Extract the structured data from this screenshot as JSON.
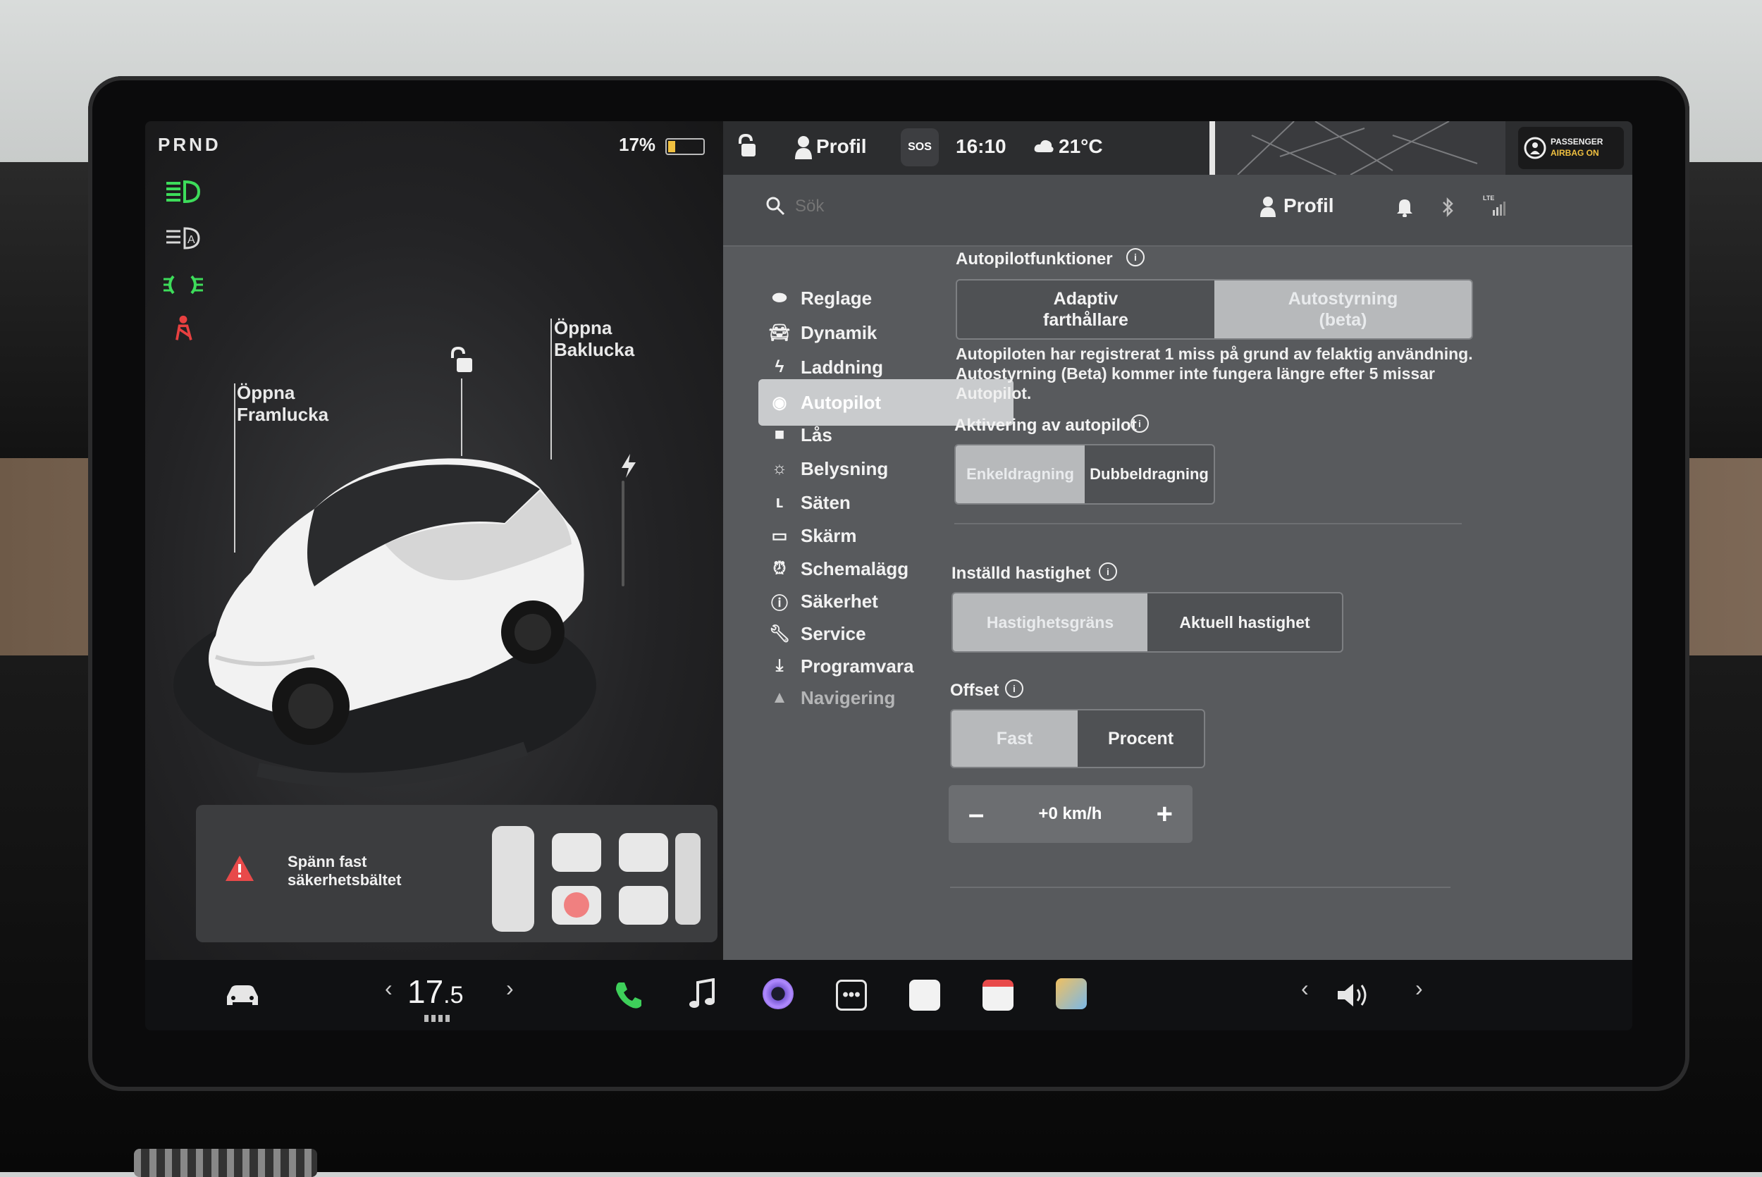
{
  "drive": {
    "gear": "PRND",
    "battery": "17%",
    "callout_frunk": "Öppna\nFramlucka",
    "callout_trunk": "Öppna\nBaklucka",
    "seatbelt_alert": "Spänn fast\nsäkerhetsbältet"
  },
  "statusbar": {
    "profile": "Profil",
    "sos": "SOS",
    "time": "16:10",
    "temperature": "21°C",
    "airbag_line1": "PASSENGER",
    "airbag_line2": "AIRBAG ON"
  },
  "search": {
    "placeholder": "Sök",
    "profile": "Profil"
  },
  "nav": {
    "items": [
      {
        "label": "Reglage",
        "icon": "toggle-icon"
      },
      {
        "label": "Dynamik",
        "icon": "car-icon"
      },
      {
        "label": "Laddning",
        "icon": "lightning-icon"
      },
      {
        "label": "Autopilot",
        "icon": "steering-wheel-icon"
      },
      {
        "label": "Lås",
        "icon": "lock-icon"
      },
      {
        "label": "Belysning",
        "icon": "sun-icon"
      },
      {
        "label": "Säten",
        "icon": "seat-icon"
      },
      {
        "label": "Skärm",
        "icon": "display-icon"
      },
      {
        "label": "Schemalägg",
        "icon": "alarm-clock-icon"
      },
      {
        "label": "Säkerhet",
        "icon": "alert-circle-icon"
      },
      {
        "label": "Service",
        "icon": "wrench-icon"
      },
      {
        "label": "Programvara",
        "icon": "download-icon"
      },
      {
        "label": "Navigering",
        "icon": "navigation-arrow-icon"
      }
    ],
    "active_index": 3
  },
  "autopilot": {
    "features_title": "Autopilotfunktioner",
    "features_options": [
      "Adaptiv\nfarthållare",
      "Autostyrning\n(beta)"
    ],
    "features_selected": 1,
    "strike_notice": "Autopiloten har registrerat 1 miss på grund av felaktig användning. Autostyrning (Beta) kommer inte fungera längre efter 5 missar Autopilot.",
    "activation_title": "Aktivering av autopilot",
    "activation_options": [
      "Enkeldragning",
      "Dubbeldragning"
    ],
    "activation_selected": 0,
    "speed_title": "Inställd hastighet",
    "speed_options": [
      "Hastighetsgräns",
      "Aktuell hastighet"
    ],
    "speed_selected": 0,
    "offset_title": "Offset",
    "offset_options": [
      "Fast",
      "Procent"
    ],
    "offset_selected": 0,
    "offset_value": "+0 km/h",
    "minus": "–",
    "plus": "+"
  },
  "taskbar": {
    "climate_temp_int": "17",
    "climate_temp_dec": ".5",
    "left_arrow": "‹",
    "right_arrow": "›"
  },
  "colors": {
    "green_indicator": "#3ddc5a",
    "red_indicator": "#e84040",
    "phone_green": "#3ecf5a",
    "active_nav": "#c9cbcd"
  }
}
